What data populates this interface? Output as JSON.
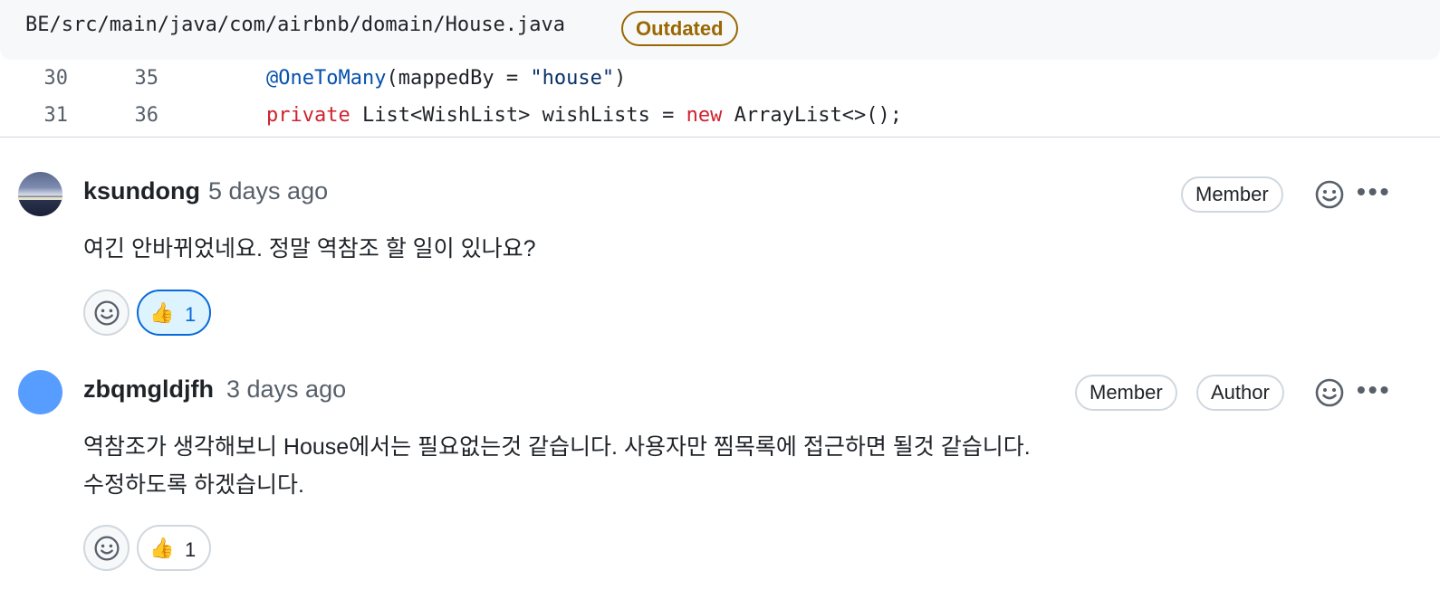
{
  "file": {
    "path": "BE/src/main/java/com/airbnb/domain/House.java",
    "status_badge": "Outdated"
  },
  "code": {
    "lines": [
      {
        "old": "30",
        "new": "35",
        "annotation": "@OneToMany",
        "paren_open": "(mappedBy = ",
        "string": "\"house\"",
        "paren_close": ")"
      },
      {
        "old": "31",
        "new": "36",
        "kw1": "private",
        "mid": " List<WishList> wishLists = ",
        "kw2": "new",
        "end": " ArrayList<>();"
      }
    ]
  },
  "comments": [
    {
      "author": "ksundong",
      "time": "5 days ago",
      "badges": [
        "Member"
      ],
      "body": [
        "여긴 안바뀌었네요. 정말 역참조 할 일이 있나요?"
      ],
      "reaction": {
        "emoji": "👍",
        "count": "1",
        "active": true
      }
    },
    {
      "author": "zbqmgldjfh",
      "time": "3 days ago",
      "badges": [
        "Member",
        "Author"
      ],
      "body": [
        "역참조가 생각해보니 House에서는 필요없는것 같습니다. 사용자만 찜목록에 접근하면 될것 같습니다.",
        "수정하도록 하겠습니다."
      ],
      "reaction": {
        "emoji": "👍",
        "count": "1",
        "active": false
      }
    }
  ],
  "icons": {
    "add_reaction": "smiley-icon",
    "more": "kebab-horizontal-icon"
  },
  "colors": {
    "outdated": "#9a6700",
    "link_blue": "#0969da",
    "keyword_red": "#cf222e"
  }
}
